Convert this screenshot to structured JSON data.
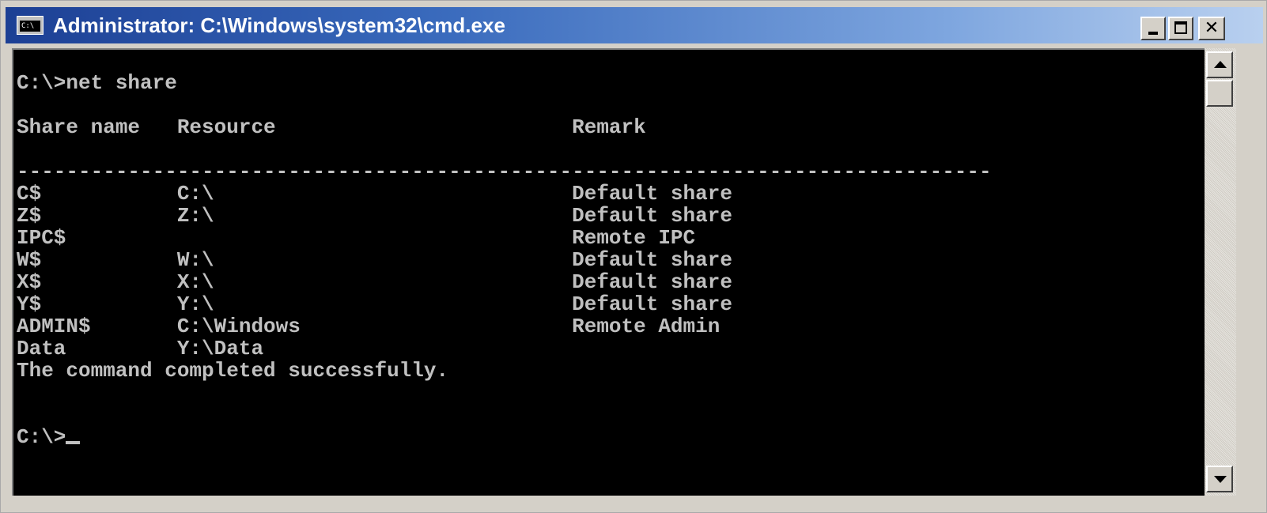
{
  "window": {
    "title": "Administrator: C:\\Windows\\system32\\cmd.exe",
    "icon": "console-app-icon",
    "icon_text": "C:\\",
    "controls": {
      "minimize": "minimize-icon",
      "maximize": "maximize-icon",
      "close_glyph": "✕"
    }
  },
  "console": {
    "lines": [
      "",
      "C:\\>net share",
      "",
      "Share name   Resource                        Remark",
      "",
      "-------------------------------------------------------------------------------",
      "C$           C:\\                             Default share",
      "Z$           Z:\\                             Default share",
      "IPC$                                         Remote IPC",
      "W$           W:\\                             Default share",
      "X$           X:\\                             Default share",
      "Y$           Y:\\                             Default share",
      "ADMIN$       C:\\Windows                      Remote Admin",
      "Data         Y:\\Data",
      "The command completed successfully.",
      "",
      "",
      "C:\\>"
    ]
  },
  "scrollbar": {
    "up_icon": "scroll-up-arrow-icon",
    "down_icon": "scroll-down-arrow-icon"
  }
}
